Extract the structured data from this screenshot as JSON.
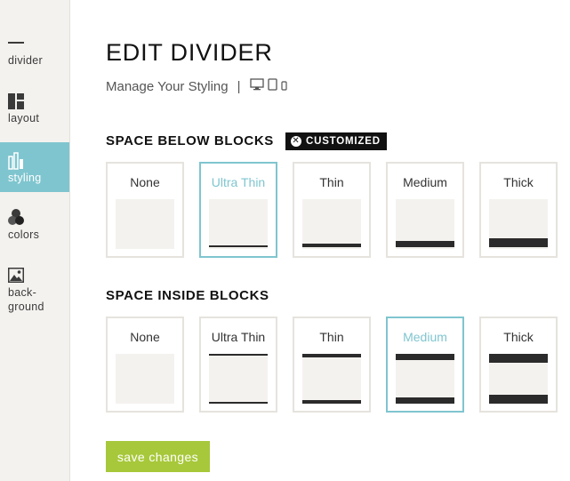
{
  "sidebar": {
    "items": [
      {
        "label": "divider",
        "icon": "minus-icon"
      },
      {
        "label": "layout",
        "icon": "layout-icon"
      },
      {
        "label": "styling",
        "icon": "styling-icon",
        "active": true
      },
      {
        "label": "colors",
        "icon": "palette-icon"
      },
      {
        "label": "back-",
        "label2": "ground",
        "icon": "image-icon"
      }
    ]
  },
  "header": {
    "title": "EDIT DIVIDER",
    "subtitle": "Manage Your Styling",
    "separator": "|",
    "devices": [
      "desktop-icon",
      "tablet-icon",
      "phone-icon"
    ]
  },
  "space_below": {
    "title": "SPACE BELOW BLOCKS",
    "badge": "CUSTOMIZED",
    "options": [
      "None",
      "Ultra Thin",
      "Thin",
      "Medium",
      "Thick"
    ],
    "selected": "Ultra Thin"
  },
  "space_inside": {
    "title": "SPACE INSIDE BLOCKS",
    "options": [
      "None",
      "Ultra Thin",
      "Thin",
      "Medium",
      "Thick"
    ],
    "selected": "Medium"
  },
  "actions": {
    "save_label": "save changes"
  },
  "colors": {
    "accent": "#7fc5cf",
    "save": "#a7c83a",
    "sidebar_bg": "#f4f2ef",
    "bar": "#2b2b2b"
  }
}
